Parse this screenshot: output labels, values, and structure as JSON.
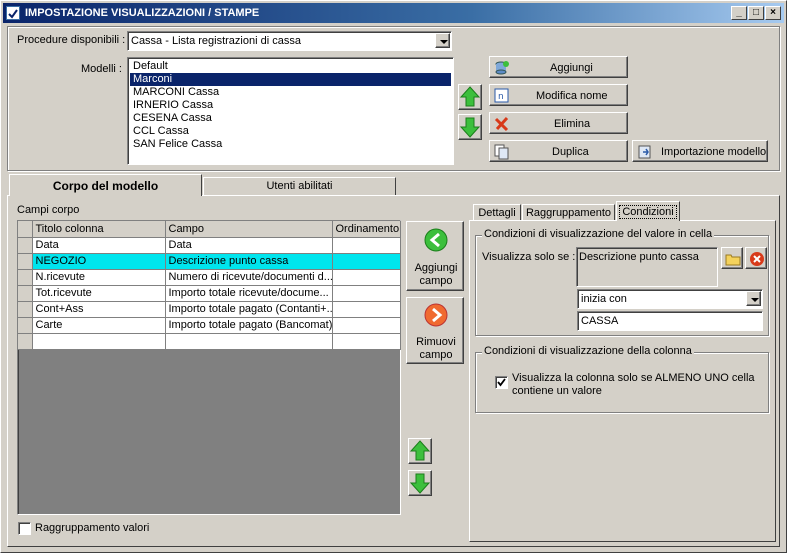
{
  "window": {
    "title": "IMPOSTAZIONE VISUALIZZAZIONI / STAMPE",
    "min": "_",
    "max": "□",
    "close": "×"
  },
  "top": {
    "procedure_label": "Procedure disponibili :",
    "procedure_value": "Cassa - Lista registrazioni di cassa",
    "modelli_label": "Modelli :",
    "modelli": [
      "Default",
      "Marconi",
      "MARCONI Cassa",
      "IRNERIO Cassa",
      "CESENA Cassa",
      "CCL Cassa",
      "SAN Felice Cassa"
    ],
    "selected_model": "Marconi",
    "buttons": {
      "aggiungi": "Aggiungi",
      "modifica": "Modifica nome",
      "elimina": "Elimina",
      "duplica": "Duplica",
      "importazione": "Importazione modello"
    }
  },
  "tabs": {
    "corpo": "Corpo del modello",
    "utenti": "Utenti abilitati"
  },
  "corpo": {
    "campi_label": "Campi corpo",
    "columns": [
      "Titolo colonna",
      "Campo",
      "Ordinamento"
    ],
    "rows": [
      {
        "titolo": "Data",
        "campo": "Data",
        "ordinamento": ""
      },
      {
        "titolo": "NEGOZIO",
        "campo": "Descrizione punto cassa",
        "ordinamento": ""
      },
      {
        "titolo": "N.ricevute",
        "campo": "Numero di ricevute/documenti d...",
        "ordinamento": ""
      },
      {
        "titolo": "Tot.ricevute",
        "campo": "Importo totale ricevute/docume...",
        "ordinamento": ""
      },
      {
        "titolo": "Cont+Ass",
        "campo": "Importo totale pagato (Contanti+...",
        "ordinamento": ""
      },
      {
        "titolo": "Carte",
        "campo": "Importo totale pagato (Bancomat)",
        "ordinamento": ""
      },
      {
        "titolo": "",
        "campo": "",
        "ordinamento": ""
      }
    ],
    "aggiungi_campo_l1": "Aggiungi",
    "aggiungi_campo_l2": "campo",
    "rimuovi_campo_l1": "Rimuovi",
    "rimuovi_campo_l2": "campo",
    "raggruppamento_valori": "Raggruppamento valori"
  },
  "subtabs": {
    "dettagli": "Dettagli",
    "raggruppamento": "Raggruppamento",
    "condizioni": "Condizioni"
  },
  "condizioni": {
    "group1_title": "Condizioni di visualizzazione del valore in cella",
    "visualizza_label": "Visualizza solo se :",
    "campo_value": "Descrizione punto cassa",
    "operatore": "inizia con",
    "valore": "CASSA",
    "group2_title": "Condizioni di visualizzazione della colonna",
    "checkbox_l1": "Visualizza la colonna solo se ALMENO UNO cella",
    "checkbox_l2": "contiene un valore",
    "checkbox_checked": true
  },
  "colors": {
    "accent": "#0a246a",
    "highlight_row": "#00e5ee",
    "up_arrow": "#2fa52f",
    "delete_x": "#d83a1a"
  }
}
